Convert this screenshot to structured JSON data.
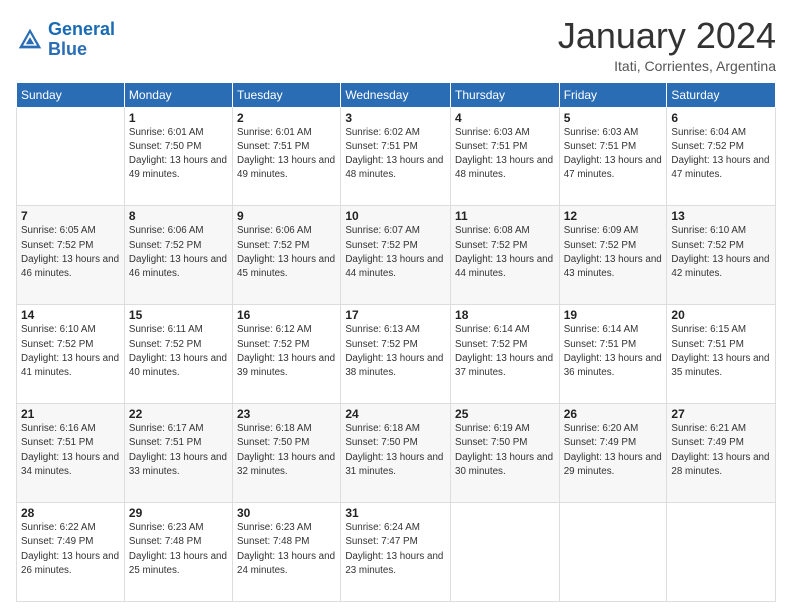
{
  "logo": {
    "line1": "General",
    "line2": "Blue"
  },
  "title": "January 2024",
  "subtitle": "Itati, Corrientes, Argentina",
  "weekdays": [
    "Sunday",
    "Monday",
    "Tuesday",
    "Wednesday",
    "Thursday",
    "Friday",
    "Saturday"
  ],
  "weeks": [
    [
      {
        "day": "",
        "sunrise": "",
        "sunset": "",
        "daylight": ""
      },
      {
        "day": "1",
        "sunrise": "Sunrise: 6:01 AM",
        "sunset": "Sunset: 7:50 PM",
        "daylight": "Daylight: 13 hours and 49 minutes."
      },
      {
        "day": "2",
        "sunrise": "Sunrise: 6:01 AM",
        "sunset": "Sunset: 7:51 PM",
        "daylight": "Daylight: 13 hours and 49 minutes."
      },
      {
        "day": "3",
        "sunrise": "Sunrise: 6:02 AM",
        "sunset": "Sunset: 7:51 PM",
        "daylight": "Daylight: 13 hours and 48 minutes."
      },
      {
        "day": "4",
        "sunrise": "Sunrise: 6:03 AM",
        "sunset": "Sunset: 7:51 PM",
        "daylight": "Daylight: 13 hours and 48 minutes."
      },
      {
        "day": "5",
        "sunrise": "Sunrise: 6:03 AM",
        "sunset": "Sunset: 7:51 PM",
        "daylight": "Daylight: 13 hours and 47 minutes."
      },
      {
        "day": "6",
        "sunrise": "Sunrise: 6:04 AM",
        "sunset": "Sunset: 7:52 PM",
        "daylight": "Daylight: 13 hours and 47 minutes."
      }
    ],
    [
      {
        "day": "7",
        "sunrise": "Sunrise: 6:05 AM",
        "sunset": "Sunset: 7:52 PM",
        "daylight": "Daylight: 13 hours and 46 minutes."
      },
      {
        "day": "8",
        "sunrise": "Sunrise: 6:06 AM",
        "sunset": "Sunset: 7:52 PM",
        "daylight": "Daylight: 13 hours and 46 minutes."
      },
      {
        "day": "9",
        "sunrise": "Sunrise: 6:06 AM",
        "sunset": "Sunset: 7:52 PM",
        "daylight": "Daylight: 13 hours and 45 minutes."
      },
      {
        "day": "10",
        "sunrise": "Sunrise: 6:07 AM",
        "sunset": "Sunset: 7:52 PM",
        "daylight": "Daylight: 13 hours and 44 minutes."
      },
      {
        "day": "11",
        "sunrise": "Sunrise: 6:08 AM",
        "sunset": "Sunset: 7:52 PM",
        "daylight": "Daylight: 13 hours and 44 minutes."
      },
      {
        "day": "12",
        "sunrise": "Sunrise: 6:09 AM",
        "sunset": "Sunset: 7:52 PM",
        "daylight": "Daylight: 13 hours and 43 minutes."
      },
      {
        "day": "13",
        "sunrise": "Sunrise: 6:10 AM",
        "sunset": "Sunset: 7:52 PM",
        "daylight": "Daylight: 13 hours and 42 minutes."
      }
    ],
    [
      {
        "day": "14",
        "sunrise": "Sunrise: 6:10 AM",
        "sunset": "Sunset: 7:52 PM",
        "daylight": "Daylight: 13 hours and 41 minutes."
      },
      {
        "day": "15",
        "sunrise": "Sunrise: 6:11 AM",
        "sunset": "Sunset: 7:52 PM",
        "daylight": "Daylight: 13 hours and 40 minutes."
      },
      {
        "day": "16",
        "sunrise": "Sunrise: 6:12 AM",
        "sunset": "Sunset: 7:52 PM",
        "daylight": "Daylight: 13 hours and 39 minutes."
      },
      {
        "day": "17",
        "sunrise": "Sunrise: 6:13 AM",
        "sunset": "Sunset: 7:52 PM",
        "daylight": "Daylight: 13 hours and 38 minutes."
      },
      {
        "day": "18",
        "sunrise": "Sunrise: 6:14 AM",
        "sunset": "Sunset: 7:52 PM",
        "daylight": "Daylight: 13 hours and 37 minutes."
      },
      {
        "day": "19",
        "sunrise": "Sunrise: 6:14 AM",
        "sunset": "Sunset: 7:51 PM",
        "daylight": "Daylight: 13 hours and 36 minutes."
      },
      {
        "day": "20",
        "sunrise": "Sunrise: 6:15 AM",
        "sunset": "Sunset: 7:51 PM",
        "daylight": "Daylight: 13 hours and 35 minutes."
      }
    ],
    [
      {
        "day": "21",
        "sunrise": "Sunrise: 6:16 AM",
        "sunset": "Sunset: 7:51 PM",
        "daylight": "Daylight: 13 hours and 34 minutes."
      },
      {
        "day": "22",
        "sunrise": "Sunrise: 6:17 AM",
        "sunset": "Sunset: 7:51 PM",
        "daylight": "Daylight: 13 hours and 33 minutes."
      },
      {
        "day": "23",
        "sunrise": "Sunrise: 6:18 AM",
        "sunset": "Sunset: 7:50 PM",
        "daylight": "Daylight: 13 hours and 32 minutes."
      },
      {
        "day": "24",
        "sunrise": "Sunrise: 6:18 AM",
        "sunset": "Sunset: 7:50 PM",
        "daylight": "Daylight: 13 hours and 31 minutes."
      },
      {
        "day": "25",
        "sunrise": "Sunrise: 6:19 AM",
        "sunset": "Sunset: 7:50 PM",
        "daylight": "Daylight: 13 hours and 30 minutes."
      },
      {
        "day": "26",
        "sunrise": "Sunrise: 6:20 AM",
        "sunset": "Sunset: 7:49 PM",
        "daylight": "Daylight: 13 hours and 29 minutes."
      },
      {
        "day": "27",
        "sunrise": "Sunrise: 6:21 AM",
        "sunset": "Sunset: 7:49 PM",
        "daylight": "Daylight: 13 hours and 28 minutes."
      }
    ],
    [
      {
        "day": "28",
        "sunrise": "Sunrise: 6:22 AM",
        "sunset": "Sunset: 7:49 PM",
        "daylight": "Daylight: 13 hours and 26 minutes."
      },
      {
        "day": "29",
        "sunrise": "Sunrise: 6:23 AM",
        "sunset": "Sunset: 7:48 PM",
        "daylight": "Daylight: 13 hours and 25 minutes."
      },
      {
        "day": "30",
        "sunrise": "Sunrise: 6:23 AM",
        "sunset": "Sunset: 7:48 PM",
        "daylight": "Daylight: 13 hours and 24 minutes."
      },
      {
        "day": "31",
        "sunrise": "Sunrise: 6:24 AM",
        "sunset": "Sunset: 7:47 PM",
        "daylight": "Daylight: 13 hours and 23 minutes."
      },
      {
        "day": "",
        "sunrise": "",
        "sunset": "",
        "daylight": ""
      },
      {
        "day": "",
        "sunrise": "",
        "sunset": "",
        "daylight": ""
      },
      {
        "day": "",
        "sunrise": "",
        "sunset": "",
        "daylight": ""
      }
    ]
  ]
}
